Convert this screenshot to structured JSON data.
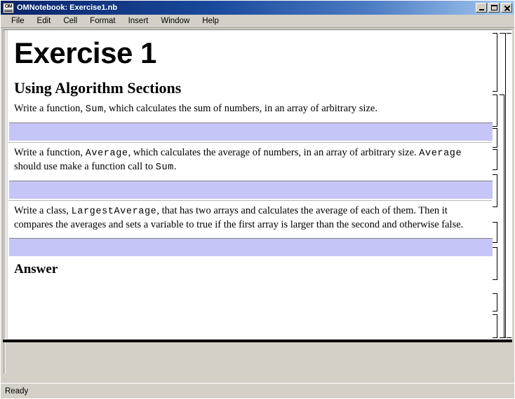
{
  "window": {
    "app_icon": "om-notebook-icon",
    "title": "OMNotebook: Exercise1.nb",
    "icon_text": "OM",
    "controls": [
      {
        "name": "minimize-button",
        "label": "–"
      },
      {
        "name": "maximize-button",
        "label": "□"
      },
      {
        "name": "close-button",
        "label": "✕"
      }
    ]
  },
  "menubar": {
    "items": [
      {
        "label": "File"
      },
      {
        "label": "Edit"
      },
      {
        "label": "Cell"
      },
      {
        "label": "Format"
      },
      {
        "label": "Insert"
      },
      {
        "label": "Window"
      },
      {
        "label": "Help"
      }
    ]
  },
  "notebook": {
    "title_cell": "Exercise 1",
    "section_cell": "Using Algorithm Sections",
    "text_cells": [
      {
        "parts": [
          {
            "type": "text",
            "value": "Write a function, "
          },
          {
            "type": "code",
            "value": "Sum"
          },
          {
            "type": "text",
            "value": ", which calculates the sum of numbers, in an array of arbitrary size."
          }
        ]
      },
      {
        "parts": [
          {
            "type": "text",
            "value": "Write a function, "
          },
          {
            "type": "code",
            "value": "Average"
          },
          {
            "type": "text",
            "value": ", which calculates the average of numbers, in an array of arbitrary size. "
          },
          {
            "type": "code",
            "value": "Average"
          },
          {
            "type": "text",
            "value": " should use make a function call to "
          },
          {
            "type": "code",
            "value": "Sum"
          },
          {
            "type": "text",
            "value": "."
          }
        ]
      },
      {
        "parts": [
          {
            "type": "text",
            "value": "Write a class, "
          },
          {
            "type": "code",
            "value": "LargestAverage"
          },
          {
            "type": "text",
            "value": ", that has two arrays and calculates the average of each of them. Then it compares the averages and sets a variable to true if the first array is larger than the second and otherwise false."
          }
        ]
      }
    ],
    "input_cells": [
      {
        "name": "input-cell-1",
        "value": ""
      },
      {
        "name": "input-cell-2",
        "value": ""
      },
      {
        "name": "input-cell-3",
        "value": ""
      }
    ],
    "answer_cell": "Answer"
  },
  "statusbar": {
    "message": "Ready"
  },
  "colors": {
    "input_cell_bg": "#c5c5f7",
    "titlebar_start": "#0a246a",
    "titlebar_end": "#a6caf0",
    "window_chrome": "#d4d0c8",
    "page_bg": "#ffffff"
  }
}
